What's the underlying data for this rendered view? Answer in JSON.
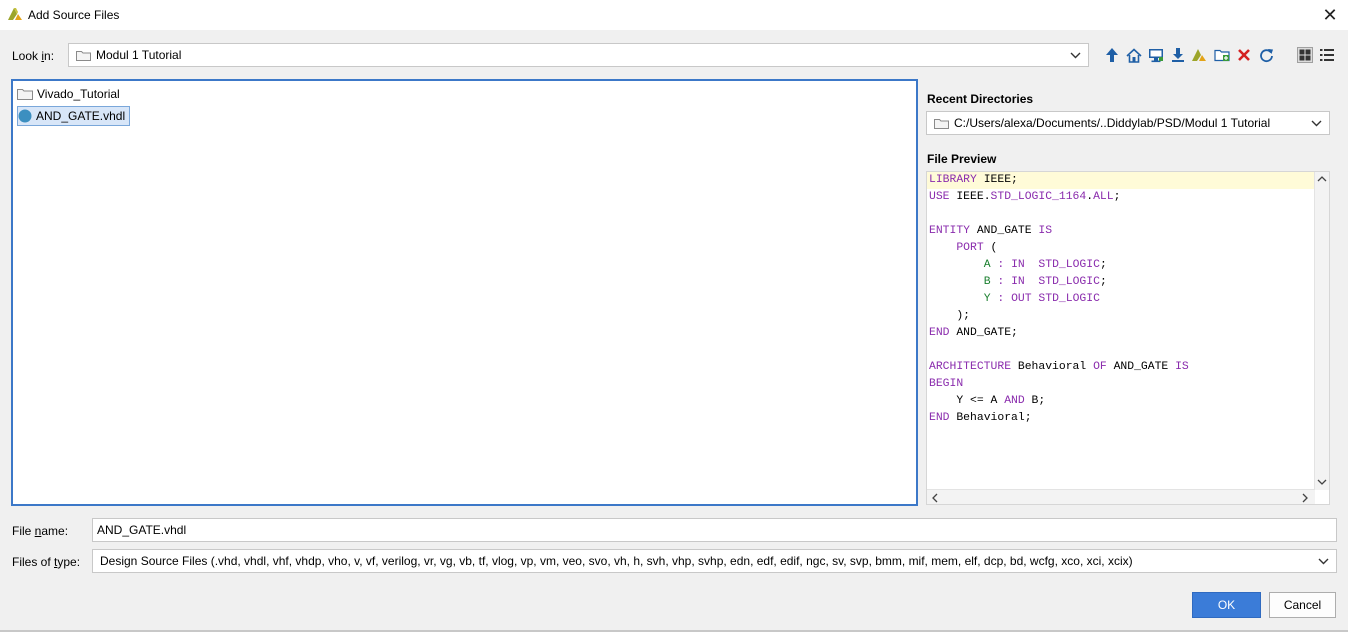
{
  "window": {
    "title": "Add Source Files",
    "close_glyph": "✕"
  },
  "look_in": {
    "label_pre": "Look ",
    "label_u": "i",
    "label_post": "n:",
    "value": "Modul 1 Tutorial"
  },
  "toolbar": {
    "icons": [
      "up-folder-icon",
      "home-icon",
      "desktop-icon",
      "download-icon",
      "vivado-project-icon",
      "new-folder-icon",
      "delete-icon",
      "refresh-icon",
      "large-icons-view-icon",
      "details-view-icon"
    ]
  },
  "file_list": {
    "items": [
      {
        "name": "Vivado_Tutorial",
        "type": "folder"
      },
      {
        "name": "AND_GATE.vhdl",
        "type": "vhdl-file",
        "selected": true
      }
    ]
  },
  "recent_directories": {
    "label": "Recent Directories",
    "value": "C:/Users/alexa/Documents/..Diddylab/PSD/Modul 1 Tutorial"
  },
  "file_preview": {
    "label": "File Preview",
    "lines": [
      [
        [
          "kw",
          "LIBRARY"
        ],
        [
          "pl",
          " IEEE;"
        ]
      ],
      [
        [
          "kw",
          "USE"
        ],
        [
          "pl",
          " IEEE."
        ],
        [
          "kw",
          "STD_LOGIC_1164"
        ],
        [
          "pl",
          "."
        ],
        [
          "kw",
          "ALL"
        ],
        [
          "pl",
          ";"
        ]
      ],
      [],
      [
        [
          "kw",
          "ENTITY"
        ],
        [
          "pl",
          " AND_GATE "
        ],
        [
          "kw",
          "IS"
        ]
      ],
      [
        [
          "pl",
          "    "
        ],
        [
          "kw",
          "PORT"
        ],
        [
          "pl",
          " ("
        ]
      ],
      [
        [
          "pl",
          "        "
        ],
        [
          "id",
          "A"
        ],
        [
          "pl",
          " "
        ],
        [
          "kw",
          ":"
        ],
        [
          "pl",
          " "
        ],
        [
          "kw",
          "IN"
        ],
        [
          "pl",
          "  "
        ],
        [
          "kw",
          "STD_LOGIC"
        ],
        [
          "pl",
          ";"
        ]
      ],
      [
        [
          "pl",
          "        "
        ],
        [
          "id",
          "B"
        ],
        [
          "pl",
          " "
        ],
        [
          "kw",
          ":"
        ],
        [
          "pl",
          " "
        ],
        [
          "kw",
          "IN"
        ],
        [
          "pl",
          "  "
        ],
        [
          "kw",
          "STD_LOGIC"
        ],
        [
          "pl",
          ";"
        ]
      ],
      [
        [
          "pl",
          "        "
        ],
        [
          "id",
          "Y"
        ],
        [
          "pl",
          " "
        ],
        [
          "kw",
          ":"
        ],
        [
          "pl",
          " "
        ],
        [
          "kw",
          "OUT"
        ],
        [
          "pl",
          " "
        ],
        [
          "kw",
          "STD_LOGIC"
        ]
      ],
      [
        [
          "pl",
          "    );"
        ]
      ],
      [
        [
          "kw",
          "END"
        ],
        [
          "pl",
          " AND_GATE;"
        ]
      ],
      [],
      [
        [
          "kw",
          "ARCHITECTURE"
        ],
        [
          "pl",
          " Behavioral "
        ],
        [
          "kw",
          "OF"
        ],
        [
          "pl",
          " AND_GATE "
        ],
        [
          "kw",
          "IS"
        ]
      ],
      [
        [
          "kw",
          "BEGIN"
        ]
      ],
      [
        [
          "pl",
          "    Y <= A "
        ],
        [
          "kw",
          "AND"
        ],
        [
          "pl",
          " B;"
        ]
      ],
      [
        [
          "kw",
          "END"
        ],
        [
          "pl",
          " Behavioral;"
        ]
      ]
    ]
  },
  "file_name": {
    "label_pre": "File ",
    "label_u": "n",
    "label_post": "ame:",
    "value": "AND_GATE.vhdl"
  },
  "files_of_type": {
    "label_pre": "Files of ",
    "label_u": "t",
    "label_post": "ype:",
    "value": "Design Source Files (.vhd, vhdl, vhf, vhdp, vho, v, vf, verilog, vr, vg, vb, tf, vlog, vp, vm, veo, svo, vh, h, svh, vhp, svhp, edn, edf, edif, ngc, sv, svp, bmm, mif, mem, elf, dcp, bd, wcfg, xco, xci, xcix)"
  },
  "buttons": {
    "ok": "OK",
    "cancel": "Cancel"
  },
  "colors": {
    "accent": "#3b7cd8",
    "keyword": "#8a2cad",
    "identifier": "#1a7f2e"
  }
}
